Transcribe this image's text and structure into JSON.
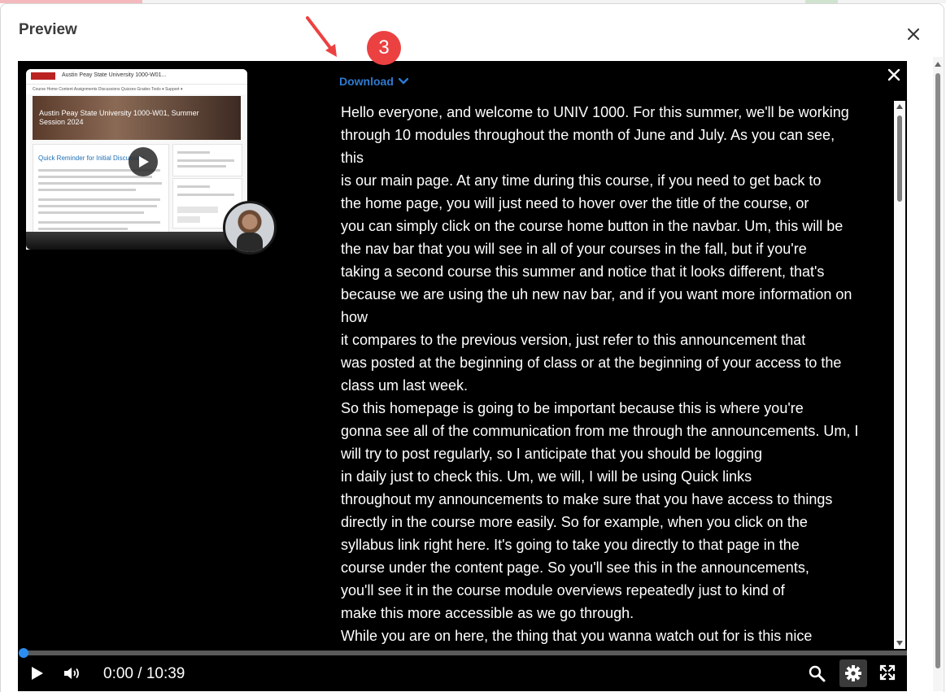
{
  "dialog": {
    "title": "Preview"
  },
  "thumbnail": {
    "course_title": "Austin Peay State University 1000-W01...",
    "banner_text": "Austin Peay State University 1000-W01, Summer Session 2024",
    "nav_text": "Course Home   Content   Assignments   Discussions   Quizzes   Grades   Tools ▾   Support ▾",
    "card_heading": "Quick Reminder for Initial Discussion"
  },
  "player": {
    "download_label": "Download",
    "time": "0:00 / 10:39",
    "progress": 0.0
  },
  "transcript": [
    "Hello everyone, and welcome to UNIV 1000. For this summer, we'll be working",
    "through 10 modules throughout the month of June and July. As you can see,",
    "this",
    "is our main page. At any time during this course, if you need to get back to",
    "the home page, you will just need to hover over the title of the course, or",
    "you can simply click on the course home button in the navbar. Um, this will be",
    "the nav bar that you will see in all of your courses in the fall, but if you're",
    "taking a second course this summer and notice that it looks different, that's",
    "because we are using the uh new nav bar, and if you want more information on",
    "how",
    "it compares to the previous version, just refer to this announcement that",
    "was posted at the beginning of class or at the beginning of your access to the",
    "class um last week.",
    "So this homepage is going to be important because this is where you're",
    "gonna see all of the communication from me through the announcements. Um, I",
    "will try to post regularly, so I anticipate that you should be logging",
    "in daily just to check this. Um, we will, I will be using Quick links",
    "throughout my announcements to make sure that you have access to things",
    "directly in the course more easily. So for example, when you click on the",
    "syllabus link right here. It's going to take you directly to that page in the",
    "course under the content page. So you'll see this in the announcements,",
    "you'll see it in the course module overviews repeatedly just to kind of",
    "make this more accessible as we go through.",
    "While you are on here, the thing that you wanna watch out for is this nice"
  ],
  "annotation": {
    "badge": "3"
  },
  "colors": {
    "accent": "#2d7ad1",
    "badge": "#ec4141",
    "progress": "#2d8cf0"
  }
}
